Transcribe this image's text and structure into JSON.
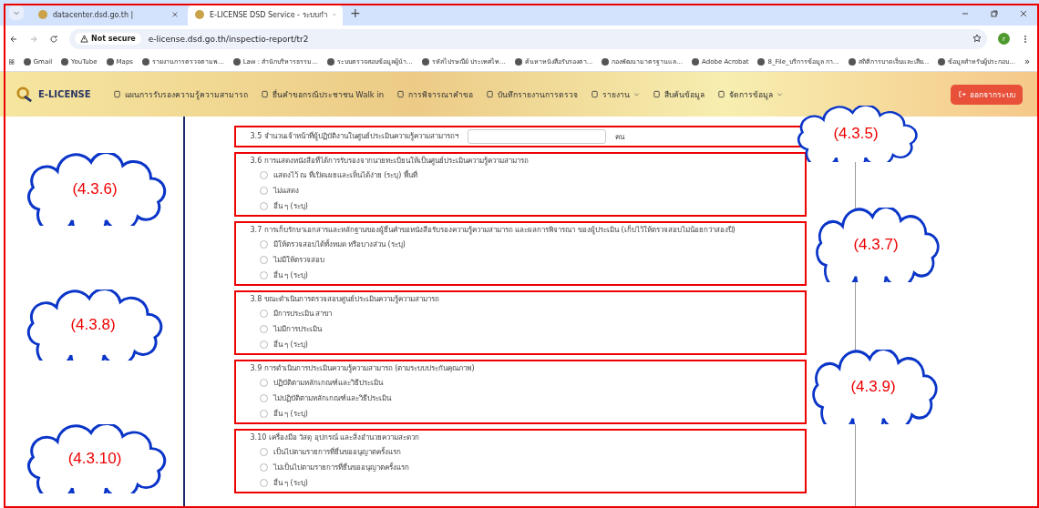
{
  "browser": {
    "tabs": [
      {
        "title": "datacenter.dsd.go.th |",
        "selected": false
      },
      {
        "title": "E-LICENSE DSD Service - ระบบกำ",
        "selected": true
      }
    ],
    "new_tab": "+",
    "address": {
      "security": "Not secure",
      "url": "e-license.dsd.go.th/inspectio-report/tr2"
    },
    "profile": "r",
    "bookmarks": [
      {
        "label": "Gmail"
      },
      {
        "label": "YouTube"
      },
      {
        "label": "Maps"
      },
      {
        "label": "รายงานการตรวจตามพ..."
      },
      {
        "label": "Law : สำนักบริหารธรรม..."
      },
      {
        "label": "ระบบตรวจสอบข้อมูลผู้นำ..."
      },
      {
        "label": "รหัสไปรษณีย์ ประเทศไท..."
      },
      {
        "label": "ค้นหาหนังสือรับรองตา..."
      },
      {
        "label": "กองพัฒนามาตรฐานแล..."
      },
      {
        "label": "Adobe Acrobat"
      },
      {
        "label": "8_File_บริการข้อมูล กา..."
      },
      {
        "label": "สถิติการบาดเจ็บและเสีย..."
      },
      {
        "label": "ข้อมูลสำหรับผู้ประกอบ..."
      }
    ],
    "more": "»"
  },
  "app": {
    "brand": "E-LICENSE",
    "nav": [
      {
        "label": "แผนการรับรองความรู้ความสามารถ",
        "dropdown": false
      },
      {
        "label": "ยื่นคำขอกรณีประชาชน Walk in",
        "dropdown": false
      },
      {
        "label": "การพิจารณาคำขอ",
        "dropdown": false
      },
      {
        "label": "บันทึกรายงานการตรวจ",
        "dropdown": false
      },
      {
        "label": "รายงาน",
        "dropdown": true
      },
      {
        "label": "สืบค้นข้อมูล",
        "dropdown": false
      },
      {
        "label": "จัดการข้อมูล",
        "dropdown": true
      }
    ],
    "logout": "ออกจากระบบ"
  },
  "questions": [
    {
      "kind": "number",
      "label": "3.5 จำนวนเจ้าหน้าที่ผู้ปฏิบัติงานในศูนย์ประเมินความรู้ความสามารถฯ",
      "unit": "คน"
    },
    {
      "kind": "choice",
      "label": "3.6 การแสดงหนังสือที่ได้การรับรองจากนายทะเบียนให้เป็นศูนย์ประเมินความรู้ความสามารถ",
      "options": [
        {
          "label": "แสดงไว้ ณ ที่เปิดเผยและเห็นได้ง่าย (ระบุ) พื้นที่",
          "selected": false
        },
        {
          "label": "ไม่แสดง",
          "selected": false
        },
        {
          "label": "อื่น ๆ (ระบุ)",
          "selected": false
        }
      ]
    },
    {
      "kind": "choice",
      "label": "3.7 การเก็บรักษาเอกสารและหลักฐานของผู้ยื่นคำขอหนังสือรับรองความรู้ความสามารถ และผลการพิจารณา ของผู้ประเมิน (เก็บไว้ให้ตรวจสอบไม่น้อยกว่าสองปี)",
      "options": [
        {
          "label": "มีให้ตรวจสอบได้ทั้งหมด หรือบางส่วน (ระบุ)",
          "selected": false
        },
        {
          "label": "ไม่มีให้ตรวจสอบ",
          "selected": false
        },
        {
          "label": "อื่น ๆ (ระบุ)",
          "selected": false
        }
      ]
    },
    {
      "kind": "choice",
      "label": "3.8 ขณะดำเนินการตรวจสอบศูนย์ประเมินความรู้ความสามารถ",
      "options": [
        {
          "label": "มีการประเมิน สาขา",
          "selected": false
        },
        {
          "label": "ไม่มีการประเมิน",
          "selected": false
        },
        {
          "label": "อื่น ๆ (ระบุ)",
          "selected": false
        }
      ]
    },
    {
      "kind": "choice",
      "label": "3.9 การดำเนินการประเมินความรู้ความสามารถ (ตามระบบประกันคุณภาพ)",
      "options": [
        {
          "label": "ปฏิบัติตามหลักเกณฑ์และวิธีประเมิน",
          "selected": false
        },
        {
          "label": "ไม่ปฏิบัติตามหลักเกณฑ์และวิธีประเมิน",
          "selected": false
        },
        {
          "label": "อื่น ๆ (ระบุ)",
          "selected": false
        }
      ]
    },
    {
      "kind": "choice",
      "label": "3.10 เครื่องมือ วัสดุ อุปกรณ์ และสิ่งอำนวยความสะดวก",
      "options": [
        {
          "label": "เป็นไปตามรายการที่ยื่นขออนุญาตครั้งแรก",
          "selected": false
        },
        {
          "label": "ไม่เป็นไปตามรายการที่ยื่นขออนุญาตครั้งแรก",
          "selected": false
        },
        {
          "label": "อื่น ๆ (ระบุ)",
          "selected": false
        }
      ]
    }
  ],
  "annotations": [
    {
      "label": "(4.3.5)"
    },
    {
      "label": "(4.3.6)"
    },
    {
      "label": "(4.3.7)"
    },
    {
      "label": "(4.3.8)"
    },
    {
      "label": "(4.3.9)"
    },
    {
      "label": "(4.3.10)"
    }
  ]
}
